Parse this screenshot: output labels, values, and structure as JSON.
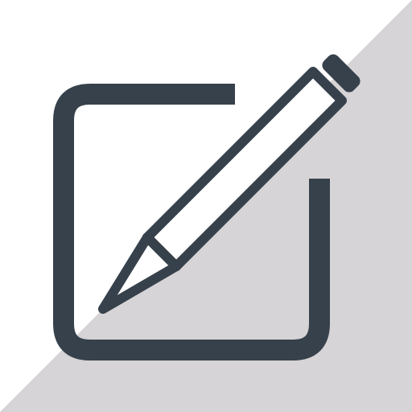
{
  "icon": {
    "name": "edit-icon",
    "depicts": "pencil-over-square"
  },
  "colors": {
    "background_light": "#FFFFFF",
    "background_shadow": "#D6D4D6",
    "stroke": "#37414B",
    "pencil_fill": "#FFFFFF"
  }
}
